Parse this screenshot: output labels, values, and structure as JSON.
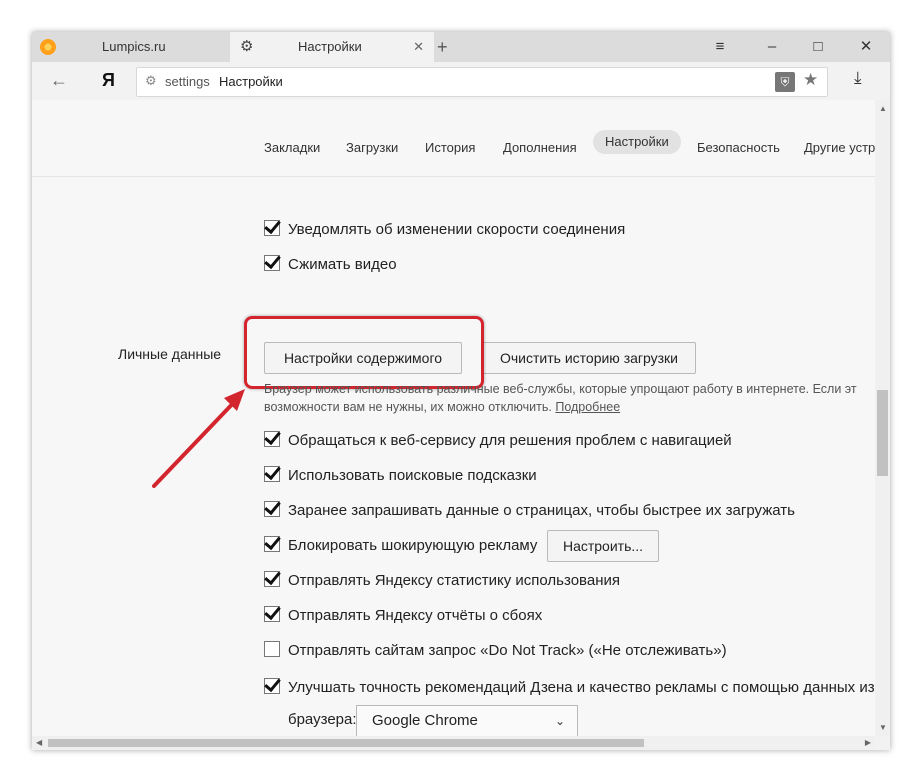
{
  "tabs": [
    {
      "title": "Lumpics.ru",
      "icon": "lumpics-logo-icon"
    },
    {
      "title": "Настройки",
      "icon": "gear-icon"
    }
  ],
  "window_controls": [
    "≡",
    "–",
    "□",
    "✕"
  ],
  "address_bar": {
    "url": "settings",
    "title": "Настройки",
    "brand": "Я"
  },
  "nav": {
    "items": [
      "Закладки",
      "Загрузки",
      "История",
      "Дополнения",
      "Настройки",
      "Безопасность",
      "Другие устрой"
    ],
    "active": "Настройки"
  },
  "settings": {
    "top_rows": [
      {
        "label": "Уведомлять об изменении скорости соединения",
        "checked": true
      },
      {
        "label": "Сжимать видео",
        "checked": true
      }
    ],
    "section_label": "Личные данные",
    "content_settings_button": "Настройки содержимого",
    "clear_history_button": "Очистить историю загрузки",
    "hint": {
      "line1": "Браузер может использовать различные веб-службы, которые упрощают работу в интернете. Если эт",
      "line2": "возможности вам не нужны, их можно отключить.",
      "link": "Подробнее"
    },
    "rows": [
      {
        "label": "Обращаться к веб-сервису для решения проблем с навигацией",
        "checked": true
      },
      {
        "label": "Использовать поисковые подсказки",
        "checked": true
      },
      {
        "label": "Заранее запрашивать данные о страницах, чтобы быстрее их загружать",
        "checked": true
      },
      {
        "label": "Блокировать шокирующую рекламу",
        "checked": true
      },
      {
        "label": "Отправлять Яндексу статистику использования",
        "checked": true
      },
      {
        "label": "Отправлять Яндексу отчёты о сбоях",
        "checked": true
      },
      {
        "label": "Отправлять сайтам запрос «Do Not Track» («Не отслеживать»)",
        "checked": false
      },
      {
        "label": "Улучшать точность рекомендаций Дзена и качество рекламы с помощью данных из",
        "checked": true
      }
    ],
    "configure_button": "Настроить...",
    "browser_label": "браузера:",
    "browser_select_value": "Google Chrome"
  },
  "colors": {
    "highlight": "#d3252d",
    "accent": "#ff9f1a"
  }
}
